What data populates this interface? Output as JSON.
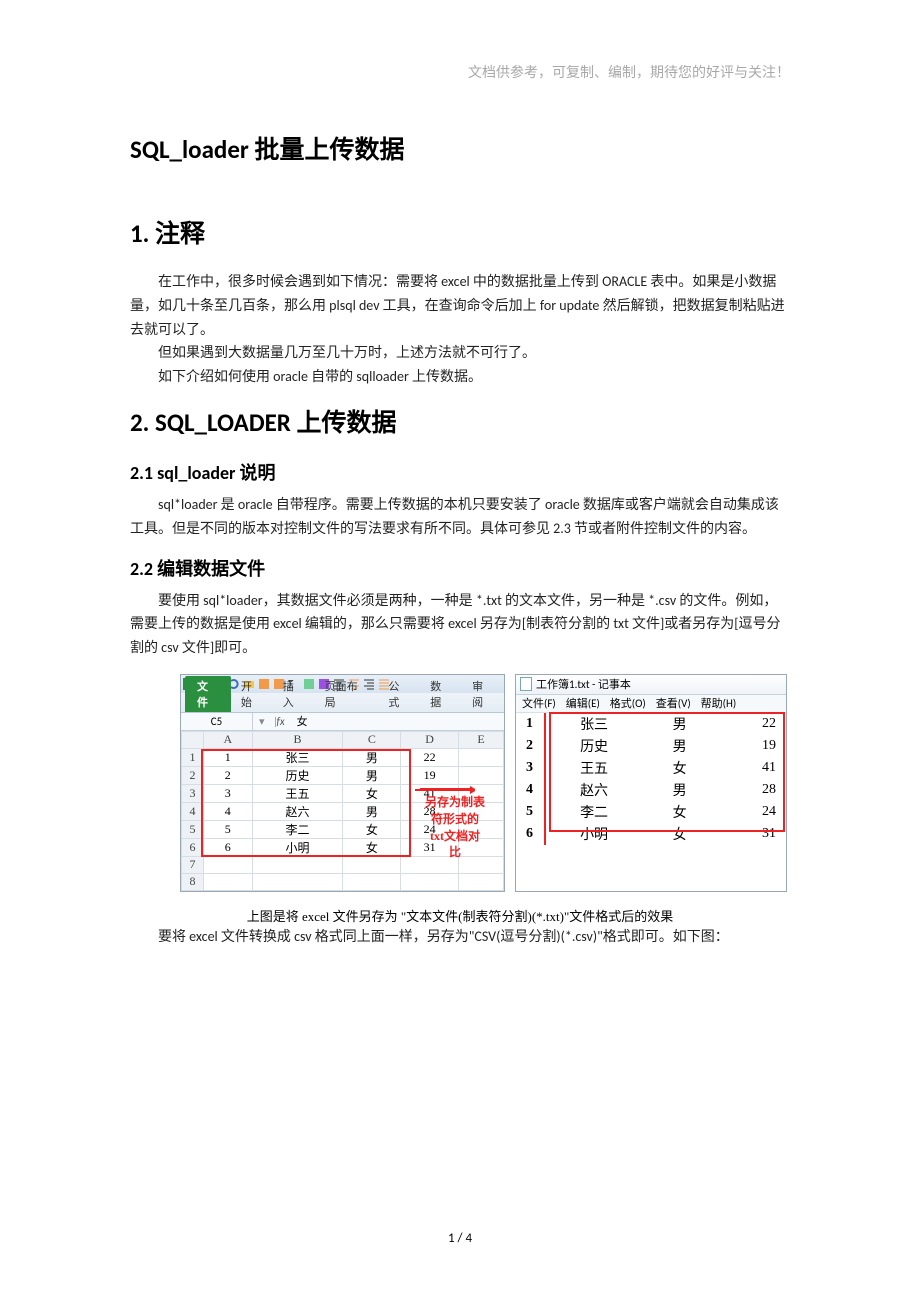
{
  "header_note": "文档供参考，可复制、编制，期待您的好评与关注！",
  "title_main": "SQL_loader 批量上传数据",
  "s1": {
    "title": "1. 注释",
    "p1": "在工作中，很多时候会遇到如下情况：需要将 excel 中的数据批量上传到 ORACLE 表中。如果是小数据量，如几十条至几百条，那么用 plsql dev 工具，在查询命令后加上 for update  然后解锁，把数据复制粘贴进去就可以了。",
    "p2": "但如果遇到大数据量几万至几十万时，上述方法就不可行了。",
    "p3": "如下介绍如何使用 oracle 自带的 sqlloader 上传数据。"
  },
  "s2": {
    "title": "2. SQL_LOADER 上传数据",
    "s21_title": "2.1  sql_loader 说明",
    "s21_p": "sql*loader 是 oracle 自带程序。需要上传数据的本机只要安装了 oracle 数据库或客户端就会自动集成该工具。但是不同的版本对控制文件的写法要求有所不同。具体可参见 2.3 节或者附件控制文件的内容。",
    "s22_title": "2.2   编辑数据文件",
    "s22_p": "要使用 sql*loader，其数据文件必须是两种，一种是 *.txt 的文本文件，另一种是 *.csv 的文件。例如，需要上传的数据是使用 excel 编辑的，那么只需要将 excel 另存为[制表符分割的 txt 文件]或者另存为[逗号分割的 csv 文件]即可。"
  },
  "excel": {
    "file_tab": "文件",
    "tabs": [
      "开始",
      "插入",
      "页面布局",
      "公式",
      "数据",
      "审阅"
    ],
    "name_box": "C5",
    "fx_label": "fx",
    "fx_value": "女",
    "col_headers": [
      "A",
      "B",
      "C",
      "D",
      "E"
    ],
    "rows": [
      {
        "n": "1",
        "a": "1",
        "b": "张三",
        "c": "男",
        "d": "22",
        "e": ""
      },
      {
        "n": "2",
        "a": "2",
        "b": "历史",
        "c": "男",
        "d": "19",
        "e": ""
      },
      {
        "n": "3",
        "a": "3",
        "b": "王五",
        "c": "女",
        "d": "41",
        "e": ""
      },
      {
        "n": "4",
        "a": "4",
        "b": "赵六",
        "c": "男",
        "d": "28",
        "e": ""
      },
      {
        "n": "5",
        "a": "5",
        "b": "李二",
        "c": "女",
        "d": "24",
        "e": ""
      },
      {
        "n": "6",
        "a": "6",
        "b": "小明",
        "c": "女",
        "d": "31",
        "e": ""
      },
      {
        "n": "7",
        "a": "",
        "b": "",
        "c": "",
        "d": "",
        "e": ""
      },
      {
        "n": "8",
        "a": "",
        "b": "",
        "c": "",
        "d": "",
        "e": ""
      }
    ],
    "side_note_l1": "另存为制表",
    "side_note_l2": "符形式的",
    "side_note_l3": "txt文档对",
    "side_note_l4": "比"
  },
  "notepad": {
    "title": "工作簿1.txt - 记事本",
    "menu": [
      "文件(F)",
      "编辑(E)",
      "格式(O)",
      "查看(V)",
      "帮助(H)"
    ],
    "rows": [
      {
        "n": "1",
        "b": "张三",
        "c": "男",
        "d": "22"
      },
      {
        "n": "2",
        "b": "历史",
        "c": "男",
        "d": "19"
      },
      {
        "n": "3",
        "b": "王五",
        "c": "女",
        "d": "41"
      },
      {
        "n": "4",
        "b": "赵六",
        "c": "男",
        "d": "28"
      },
      {
        "n": "5",
        "b": "李二",
        "c": "女",
        "d": "24"
      },
      {
        "n": "6",
        "b": "小明",
        "c": "女",
        "d": "31"
      }
    ]
  },
  "caption": "上图是将 excel 文件另存为 \"文本文件(制表符分割)(*.txt)\"文件格式后的效果",
  "post_caption": "要将 excel 文件转换成 csv 格式同上面一样，另存为\"CSV(逗号分割)(*.csv)\"格式即可。如下图：",
  "page_num": "1  /  4"
}
